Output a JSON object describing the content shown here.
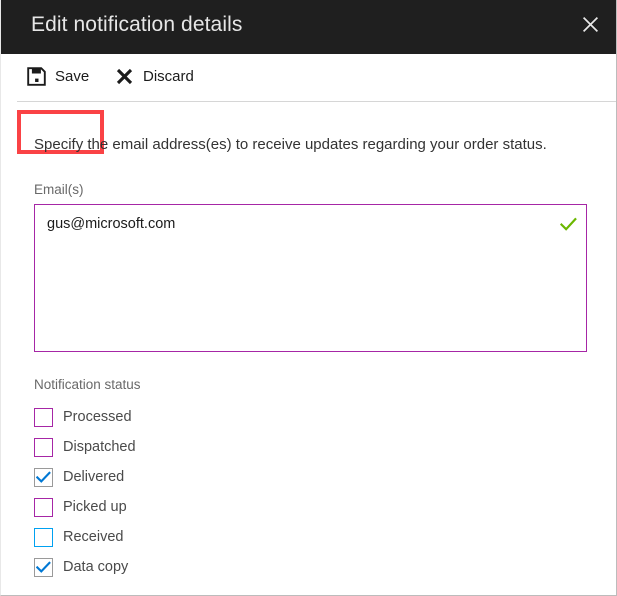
{
  "window": {
    "title": "Edit notification details",
    "close_icon": "close-icon",
    "close_glyph": "✕"
  },
  "toolbar": {
    "commands": [
      {
        "label": "Save",
        "icon": "save-icon",
        "highlighted": true
      },
      {
        "label": "Discard",
        "icon": "discard-icon",
        "highlighted": false
      }
    ]
  },
  "annotation": {
    "target": "Save",
    "color": "#fa4245"
  },
  "body": {
    "intro_text": "Specify the email address(es) to receive updates regarding your order status.",
    "email_field": {
      "label": "Email(s)",
      "value": "gus@microsoft.com",
      "placeholder": "",
      "valid_icon": "checkmark-icon",
      "valid_color": "#6bb700",
      "border_color": "#a626a6"
    },
    "notification_status": {
      "label": "Notification status",
      "items": [
        {
          "label": "Processed",
          "checked": false,
          "state": "normal"
        },
        {
          "label": "Dispatched",
          "checked": false,
          "state": "normal"
        },
        {
          "label": "Delivered",
          "checked": true,
          "state": "checked"
        },
        {
          "label": "Picked up",
          "checked": false,
          "state": "normal"
        },
        {
          "label": "Received",
          "checked": false,
          "state": "focus"
        },
        {
          "label": "Data copy",
          "checked": true,
          "state": "checked"
        }
      ]
    }
  },
  "colors": {
    "titlebar_bg": "#1f1f1f",
    "accent_purple": "#a626a6",
    "accent_blue": "#0078d4",
    "focus_blue": "#00a1f1",
    "valid_green": "#6bb700",
    "annotation_red": "#fa4245"
  }
}
